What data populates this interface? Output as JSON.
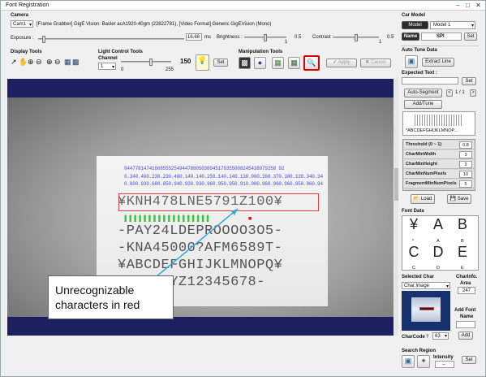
{
  "window": {
    "title": "Font Registration"
  },
  "camera": {
    "section_label": "Camera",
    "selector_value": "Cam1",
    "description": "[Frame Grabber] GigE Vision: Basler acA1920-40gm (22822781),   [Video Format] Generic GigEVision (Mono)",
    "exposure_label": "Exposure :",
    "exposure_value": "16.66",
    "exposure_unit": "ms",
    "brightness_label": "Brightness :",
    "brightness_min": "1",
    "brightness_value": "0.5",
    "contrast_label": "Contrast :",
    "contrast_min": "1",
    "contrast_value": "0.5"
  },
  "display_tools": {
    "label": "Display Tools"
  },
  "light_control": {
    "label": "Light Control Tools",
    "channel_label": "Channel",
    "channel_value": "1",
    "min": "0",
    "max": "255",
    "value": "150",
    "set_label": "Set"
  },
  "manipulation": {
    "label": "Manipulation Tools",
    "apply_label": "Apply",
    "cancel_label": "Cancel"
  },
  "viewer": {
    "blue_row1": "8447781474166855525494478805038945179355008245438979258 92",
    "blue_row2": "0.340.460.230.230.460.140.140.250.140.140.130.000.260.370.100.130.340.34",
    "blue_row3": "0.800.930.680.850.940.930.930.960.950.950.910.000.960.960.960.950.960.94",
    "line1": "¥KNH478LNE5791Z100¥",
    "greenbars": "▐▐▐▐▐▐▐▐▐▐▐▐▐▐▐▐▐▐",
    "line2": "-PAY24LDEPROOOO3O5-",
    "line3": "-KNA45000?AFM6589T-",
    "line4": "¥ABCDEFGHIJKLMNOPQ¥",
    "line5": "¥TUVWXYZ12345678-"
  },
  "annotation": {
    "line1": "Unrecognizable",
    "line2": "characters in red"
  },
  "car_model": {
    "section_label": "Car Model",
    "model_label": "Model",
    "model_value": "Model 1",
    "name_label": "Name",
    "name_value": "SPI",
    "set_label": "Set"
  },
  "auto_tune": {
    "section_label": "Auto Tune Data",
    "extract_label": "Extract Line",
    "expected_label": "Expected Text :",
    "set_label": "Set",
    "segment_label": "Auto-Segment",
    "page_text": "1 / 1",
    "add_tune_label": "Add/Tune",
    "preview_text": "*ABCDEFGHIJKLMNOP..."
  },
  "params": [
    {
      "key": "Threshold (0 ~ 1)",
      "value": "0.8"
    },
    {
      "key": "CharMinWidth",
      "value": "3"
    },
    {
      "key": "CharMinHeight",
      "value": "3"
    },
    {
      "key": "CharMinNumPixels",
      "value": "10"
    },
    {
      "key": "FragmentMinNumPixels",
      "value": "5"
    }
  ],
  "buttons": {
    "load_label": "Load",
    "save_label": "Save"
  },
  "font_data": {
    "section_label": "Font Data",
    "glyphs": [
      {
        "char": "¥",
        "label": "*"
      },
      {
        "char": "A",
        "label": "A"
      },
      {
        "char": "B",
        "label": "B"
      },
      {
        "char": "C",
        "label": "C"
      },
      {
        "char": "D",
        "label": "D"
      },
      {
        "char": "E",
        "label": "E"
      }
    ]
  },
  "selected_char": {
    "section_label": "Selected Char",
    "dropdown_value": "Char.Image",
    "charinfo_label": "CharInfo.",
    "area_label": "Area",
    "area_value": "247",
    "add_font_label": "Add Font",
    "name_label": "Name",
    "add_label": "Add",
    "charcode_label": "CharCode",
    "charcode_char": "?",
    "charcode_value": "63"
  },
  "search_region": {
    "section_label": "Search Region",
    "intensity_label": "Intensity",
    "intensity_value": "--",
    "set_label": "Set"
  }
}
